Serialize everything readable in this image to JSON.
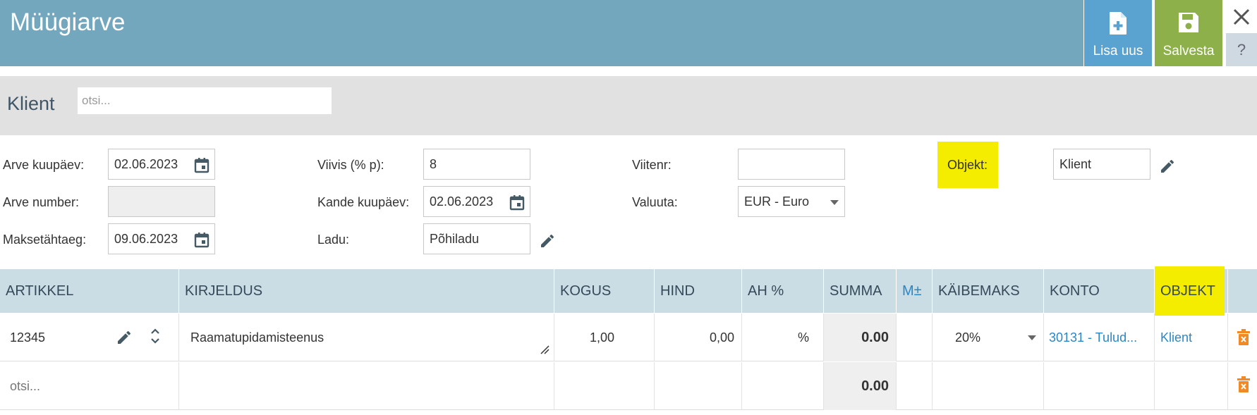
{
  "header": {
    "title": "Müügiarve",
    "add_label": "Lisa uus",
    "save_label": "Salvesta",
    "help_label": "?"
  },
  "client": {
    "label": "Klient",
    "placeholder": "otsi..."
  },
  "form": {
    "arve_kuupaev_label": "Arve kuupäev:",
    "arve_kuupaev": "02.06.2023",
    "arve_number_label": "Arve number:",
    "arve_number": "",
    "maksetahtaeg_label": "Maksetähtaeg:",
    "maksetahtaeg": "09.06.2023",
    "viivis_label": "Viivis (% p):",
    "viivis": "8",
    "kande_kuupaev_label": "Kande kuupäev:",
    "kande_kuupaev": "02.06.2023",
    "ladu_label": "Ladu:",
    "ladu": "Põhiladu",
    "viitenr_label": "Viitenr:",
    "viitenr": "",
    "valuuta_label": "Valuuta:",
    "valuuta": "EUR - Euro",
    "objekt_label": "Objekt:",
    "objekt": "Klient"
  },
  "table": {
    "columns": [
      "ARTIKKEL",
      "KIRJELDUS",
      "KOGUS",
      "HIND",
      "AH %",
      "SUMMA",
      "M±",
      "KÄIBEMAKS",
      "KONTO",
      "OBJEKT"
    ],
    "rows": [
      {
        "artikkel": "12345",
        "kirjeldus": "Raamatupidamisteenus",
        "kogus": "1,00",
        "hind": "0,00",
        "ah": "%",
        "summa": "0.00",
        "kaibemaks": "20%",
        "konto": "30131 - Tulud...",
        "objekt": "Klient"
      },
      {
        "artikkel": "otsi...",
        "summa": "0.00"
      }
    ]
  },
  "colors": {
    "header_bg": "#73a7bd",
    "add_button": "#5aa2d0",
    "save_button": "#8db04a",
    "highlight": "#f4ed00",
    "link": "#2b86c5",
    "trash": "#f08a24"
  },
  "icons": [
    "add-file-icon",
    "save-icon",
    "close-icon",
    "calendar-icon",
    "pencil-icon",
    "sort-arrows-icon",
    "resize-icon",
    "dropdown-arrow-icon",
    "trash-icon"
  ]
}
